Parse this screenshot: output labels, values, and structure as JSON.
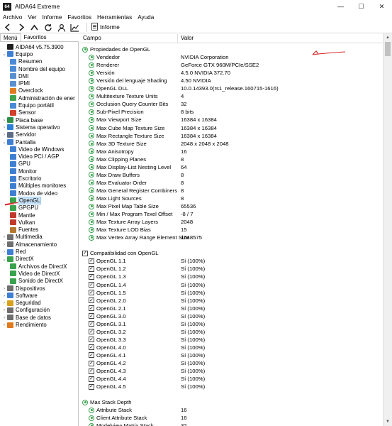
{
  "window": {
    "badge": "64",
    "title": "AIDA64 Extreme",
    "controls": [
      "—",
      "☐",
      "✕"
    ]
  },
  "menubar": [
    "Archivo",
    "Ver",
    "Informe",
    "Favoritos",
    "Herramientas",
    "Ayuda"
  ],
  "toolbar": {
    "report_label": "Informe",
    "icons": [
      "back-arrow-icon",
      "forward-arrow-icon",
      "up-arrow-icon",
      "refresh-icon",
      "user-icon",
      "chart-icon"
    ]
  },
  "left_tabs": [
    "Menú",
    "Favoritos"
  ],
  "tree": [
    {
      "label": "AIDA64 v5.75.3900",
      "level": 0,
      "arrow": "",
      "icon": "aida-icon",
      "color": "#1f1f1f"
    },
    {
      "label": "Equipo",
      "level": 0,
      "arrow": "⌄",
      "icon": "computer-icon",
      "color": "#3f7fd2"
    },
    {
      "label": "Resumen",
      "level": 1,
      "arrow": "",
      "icon": "summary-icon",
      "color": "#4b8ad6"
    },
    {
      "label": "Nombre del equipo",
      "level": 1,
      "arrow": "",
      "icon": "computer-name-icon",
      "color": "#4b8ad6"
    },
    {
      "label": "DMI",
      "level": 1,
      "arrow": "",
      "icon": "dmi-icon",
      "color": "#5a8fcf"
    },
    {
      "label": "IPMI",
      "level": 1,
      "arrow": "",
      "icon": "ipmi-icon",
      "color": "#5a8fcf"
    },
    {
      "label": "Overclock",
      "level": 1,
      "arrow": "",
      "icon": "overclock-icon",
      "color": "#e07a1e"
    },
    {
      "label": "Administración de ener",
      "level": 1,
      "arrow": "",
      "icon": "power-icon",
      "color": "#3fa34d"
    },
    {
      "label": "Equipo portátil",
      "level": 1,
      "arrow": "",
      "icon": "laptop-icon",
      "color": "#4b8ad6"
    },
    {
      "label": "Sensor",
      "level": 1,
      "arrow": "",
      "icon": "sensor-icon",
      "color": "#d0402a"
    },
    {
      "label": "Placa base",
      "level": 0,
      "arrow": "›",
      "icon": "motherboard-icon",
      "color": "#2f8f4a"
    },
    {
      "label": "Sistema operativo",
      "level": 0,
      "arrow": "›",
      "icon": "windows-icon",
      "color": "#2d7fd5"
    },
    {
      "label": "Servidor",
      "level": 0,
      "arrow": "›",
      "icon": "server-icon",
      "color": "#5b6c85"
    },
    {
      "label": "Pantalla",
      "level": 0,
      "arrow": "⌄",
      "icon": "display-icon",
      "color": "#3f7fd2"
    },
    {
      "label": "Video de Windows",
      "level": 1,
      "arrow": "",
      "icon": "windows-video-icon",
      "color": "#3f7fd2"
    },
    {
      "label": "Video PCI / AGP",
      "level": 1,
      "arrow": "",
      "icon": "pci-video-icon",
      "color": "#3f7fd2"
    },
    {
      "label": "GPU",
      "level": 1,
      "arrow": "",
      "icon": "gpu-icon",
      "color": "#3f7fd2"
    },
    {
      "label": "Monitor",
      "level": 1,
      "arrow": "",
      "icon": "monitor-icon",
      "color": "#3f7fd2"
    },
    {
      "label": "Escritorio",
      "level": 1,
      "arrow": "",
      "icon": "desktop-icon",
      "color": "#3f7fd2"
    },
    {
      "label": "Múltiples monitores",
      "level": 1,
      "arrow": "",
      "icon": "multi-monitor-icon",
      "color": "#3f7fd2"
    },
    {
      "label": "Modos de video",
      "level": 1,
      "arrow": "",
      "icon": "video-modes-icon",
      "color": "#3f7fd2"
    },
    {
      "label": "OpenGL",
      "level": 1,
      "arrow": "",
      "icon": "opengl-icon",
      "color": "#3aa24e",
      "selected": true
    },
    {
      "label": "GPGPU",
      "level": 1,
      "arrow": "",
      "icon": "gpgpu-icon",
      "color": "#3aa24e"
    },
    {
      "label": "Mantle",
      "level": 1,
      "arrow": "",
      "icon": "mantle-icon",
      "color": "#c0392b"
    },
    {
      "label": "Vulkan",
      "level": 1,
      "arrow": "",
      "icon": "vulkan-icon",
      "color": "#c0392b"
    },
    {
      "label": "Fuentes",
      "level": 1,
      "arrow": "",
      "icon": "fonts-icon",
      "color": "#b5772f"
    },
    {
      "label": "Multimedia",
      "level": 0,
      "arrow": "›",
      "icon": "multimedia-icon",
      "color": "#6f6f6f"
    },
    {
      "label": "Almacenamiento",
      "level": 0,
      "arrow": "›",
      "icon": "storage-icon",
      "color": "#6f6f6f"
    },
    {
      "label": "Red",
      "level": 0,
      "arrow": "›",
      "icon": "network-icon",
      "color": "#3f7fd2"
    },
    {
      "label": "DirectX",
      "level": 0,
      "arrow": "⌄",
      "icon": "directx-icon",
      "color": "#3aa24e"
    },
    {
      "label": "Archivos de DirectX",
      "level": 1,
      "arrow": "",
      "icon": "directx-files-icon",
      "color": "#3aa24e"
    },
    {
      "label": "Video de DirectX",
      "level": 1,
      "arrow": "",
      "icon": "directx-video-icon",
      "color": "#3aa24e"
    },
    {
      "label": "Sonido de DirectX",
      "level": 1,
      "arrow": "",
      "icon": "directx-sound-icon",
      "color": "#3aa24e"
    },
    {
      "label": "Dispositivos",
      "level": 0,
      "arrow": "›",
      "icon": "devices-icon",
      "color": "#6f6f6f"
    },
    {
      "label": "Software",
      "level": 0,
      "arrow": "›",
      "icon": "software-icon",
      "color": "#3f7fd2"
    },
    {
      "label": "Seguridad",
      "level": 0,
      "arrow": "›",
      "icon": "security-icon",
      "color": "#d6a21e"
    },
    {
      "label": "Configuración",
      "level": 0,
      "arrow": "›",
      "icon": "configuration-icon",
      "color": "#6f6f6f"
    },
    {
      "label": "Base de datos",
      "level": 0,
      "arrow": "›",
      "icon": "database-icon",
      "color": "#6f6f6f"
    },
    {
      "label": "Rendimiento",
      "level": 0,
      "arrow": "›",
      "icon": "performance-icon",
      "color": "#e07a1e"
    }
  ],
  "columns": {
    "campo": "Campo",
    "valor": "Valor"
  },
  "sections": [
    {
      "title": "Propiedades de OpenGL",
      "icon": "opengl-icon",
      "kind": "item",
      "rows": [
        {
          "campo": "Vendedor",
          "valor": "NVIDIA Corporation"
        },
        {
          "campo": "Renderer",
          "valor": "GeForce GTX 960M/PCIe/SSE2"
        },
        {
          "campo": "Versión",
          "valor": "4.5.0 NVIDIA 372.70"
        },
        {
          "campo": "Versión del lenguaje Shading",
          "valor": "4.50 NVIDIA"
        },
        {
          "campo": "OpenGL DLL",
          "valor": "10.0.14393.0(rs1_release.160715-1616)"
        },
        {
          "campo": "Multitexture Texture Units",
          "valor": "4"
        },
        {
          "campo": "Occlusion Query Counter Bits",
          "valor": "32"
        },
        {
          "campo": "Sub-Pixel Precision",
          "valor": "8 bits"
        },
        {
          "campo": "Max Viewport Size",
          "valor": "16384 x 16384"
        },
        {
          "campo": "Max Cube Map Texture Size",
          "valor": "16384 x 16384"
        },
        {
          "campo": "Max Rectangle Texture Size",
          "valor": "16384 x 16384"
        },
        {
          "campo": "Max 3D Texture Size",
          "valor": "2048 x 2048 x 2048"
        },
        {
          "campo": "Max Anisotropy",
          "valor": "16"
        },
        {
          "campo": "Max Clipping Planes",
          "valor": "8"
        },
        {
          "campo": "Max Display-List Nesting Level",
          "valor": "64"
        },
        {
          "campo": "Max Draw Buffers",
          "valor": "8"
        },
        {
          "campo": "Max Evaluator Order",
          "valor": "8"
        },
        {
          "campo": "Max General Register Combiners",
          "valor": "8"
        },
        {
          "campo": "Max Light Sources",
          "valor": "8"
        },
        {
          "campo": "Max Pixel Map Table Size",
          "valor": "65536"
        },
        {
          "campo": "Min / Max Program Texel Offset",
          "valor": "-8 / 7"
        },
        {
          "campo": "Max Texture Array Layers",
          "valor": "2048"
        },
        {
          "campo": "Max Texture LOD Bias",
          "valor": "15"
        },
        {
          "campo": "Max Vertex Array Range Element Size",
          "valor": "1048575"
        }
      ]
    },
    {
      "title": "Compatibilidad con OpenGL",
      "icon": "checkbox-icon",
      "kind": "check",
      "rows": [
        {
          "campo": "OpenGL 1.1",
          "valor": "Sí  (100%)"
        },
        {
          "campo": "OpenGL 1.2",
          "valor": "Sí  (100%)"
        },
        {
          "campo": "OpenGL 1.3",
          "valor": "Sí  (100%)"
        },
        {
          "campo": "OpenGL 1.4",
          "valor": "Sí  (100%)"
        },
        {
          "campo": "OpenGL 1.5",
          "valor": "Sí  (100%)"
        },
        {
          "campo": "OpenGL 2.0",
          "valor": "Sí  (100%)"
        },
        {
          "campo": "OpenGL 2.1",
          "valor": "Sí  (100%)"
        },
        {
          "campo": "OpenGL 3.0",
          "valor": "Sí  (100%)"
        },
        {
          "campo": "OpenGL 3.1",
          "valor": "Sí  (100%)"
        },
        {
          "campo": "OpenGL 3.2",
          "valor": "Sí  (100%)"
        },
        {
          "campo": "OpenGL 3.3",
          "valor": "Sí  (100%)"
        },
        {
          "campo": "OpenGL 4.0",
          "valor": "Sí  (100%)"
        },
        {
          "campo": "OpenGL 4.1",
          "valor": "Sí  (100%)"
        },
        {
          "campo": "OpenGL 4.2",
          "valor": "Sí  (100%)"
        },
        {
          "campo": "OpenGL 4.3",
          "valor": "Sí  (100%)"
        },
        {
          "campo": "OpenGL 4.4",
          "valor": "Sí  (100%)"
        },
        {
          "campo": "OpenGL 4.5",
          "valor": "Sí  (100%)"
        }
      ]
    },
    {
      "title": "Max Stack Depth",
      "icon": "opengl-icon",
      "kind": "item",
      "rows": [
        {
          "campo": "Attribute Stack",
          "valor": "16"
        },
        {
          "campo": "Client Attribute Stack",
          "valor": "16"
        },
        {
          "campo": "Modelview Matrix Stack",
          "valor": "32"
        }
      ]
    }
  ],
  "colors": {
    "accent": "#3aa24e",
    "selection": "#cce4f7",
    "annotation": "#d62020"
  }
}
